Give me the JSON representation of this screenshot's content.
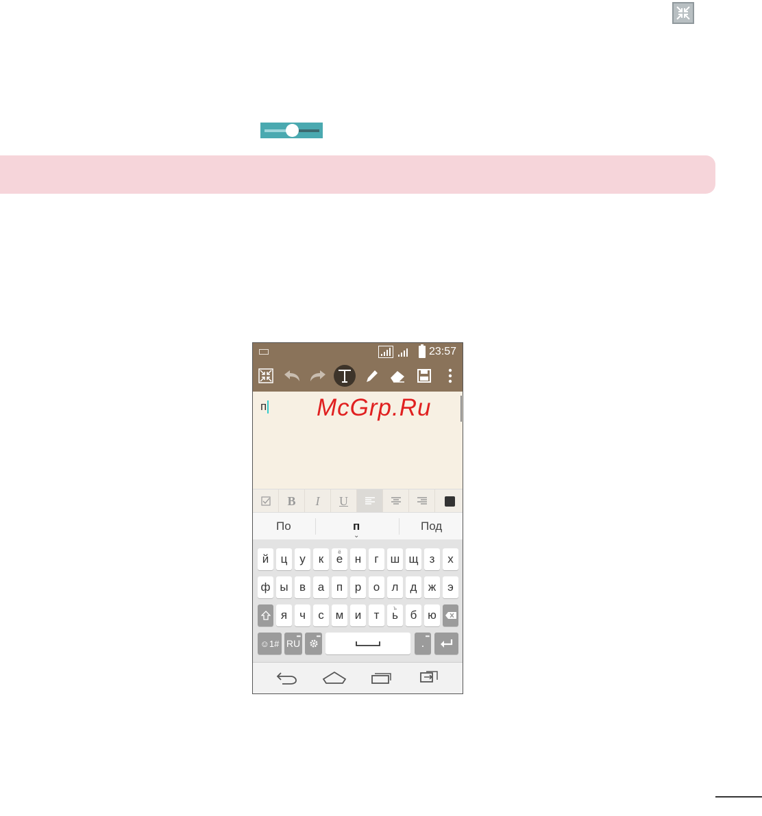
{
  "phone": {
    "status": {
      "time": "23:57"
    },
    "toolbar": {
      "buttons": [
        "minimize-icon",
        "undo-icon",
        "redo-icon",
        "text-icon",
        "pen-icon",
        "eraser-icon",
        "save-icon",
        "more-icon"
      ]
    },
    "editor": {
      "text": "п",
      "watermark": "McGrp.Ru"
    },
    "format": {
      "bold": "B",
      "italic": "I",
      "underline": "U"
    },
    "suggestions": {
      "left": "По",
      "middle": "п",
      "right": "Под"
    },
    "keyboard": {
      "row1": [
        "й",
        "ц",
        "у",
        "к",
        "е",
        "н",
        "г",
        "ш",
        "щ",
        "з",
        "х"
      ],
      "row2": [
        "ф",
        "ы",
        "в",
        "а",
        "п",
        "р",
        "о",
        "л",
        "д",
        "ж",
        "э"
      ],
      "row3": [
        "я",
        "ч",
        "с",
        "м",
        "и",
        "т",
        "ь",
        "б",
        "ю"
      ],
      "e_sup": "ё",
      "soft_sup": "ъ",
      "symbols_label": "☺1#",
      "lang_label": "RU",
      "period_label": "."
    }
  }
}
